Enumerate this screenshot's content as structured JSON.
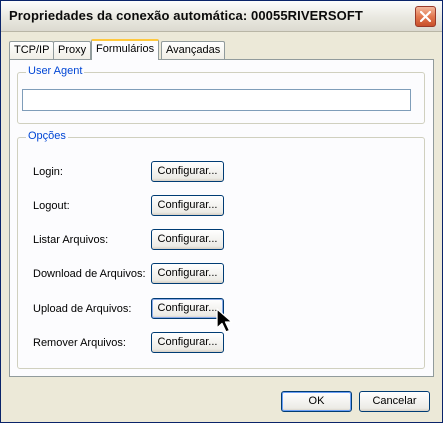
{
  "window": {
    "title": "Propriedades da conexão automática: 00055RIVERSOFT"
  },
  "tabs": [
    {
      "label": "TCP/IP",
      "active": false
    },
    {
      "label": "Proxy",
      "active": false
    },
    {
      "label": "Formulários",
      "active": true
    },
    {
      "label": "Avançadas",
      "active": false
    }
  ],
  "user_agent": {
    "group_label": "User Agent",
    "value": ""
  },
  "options": {
    "group_label": "Opções",
    "rows": [
      {
        "label": "Login:",
        "button": "Configurar..."
      },
      {
        "label": "Logout:",
        "button": "Configurar..."
      },
      {
        "label": "Listar Arquivos:",
        "button": "Configurar..."
      },
      {
        "label": "Download de Arquivos:",
        "button": "Configurar..."
      },
      {
        "label": "Upload de Arquivos:",
        "button": "Configurar..."
      },
      {
        "label": "Remover Arquivos:",
        "button": "Configurar..."
      }
    ]
  },
  "footer": {
    "ok_label": "OK",
    "cancel_label": "Cancelar"
  },
  "colors": {
    "accent_blue": "#0046d5",
    "tab_highlight": "#ffc83c",
    "close_red": "#e2784f"
  }
}
